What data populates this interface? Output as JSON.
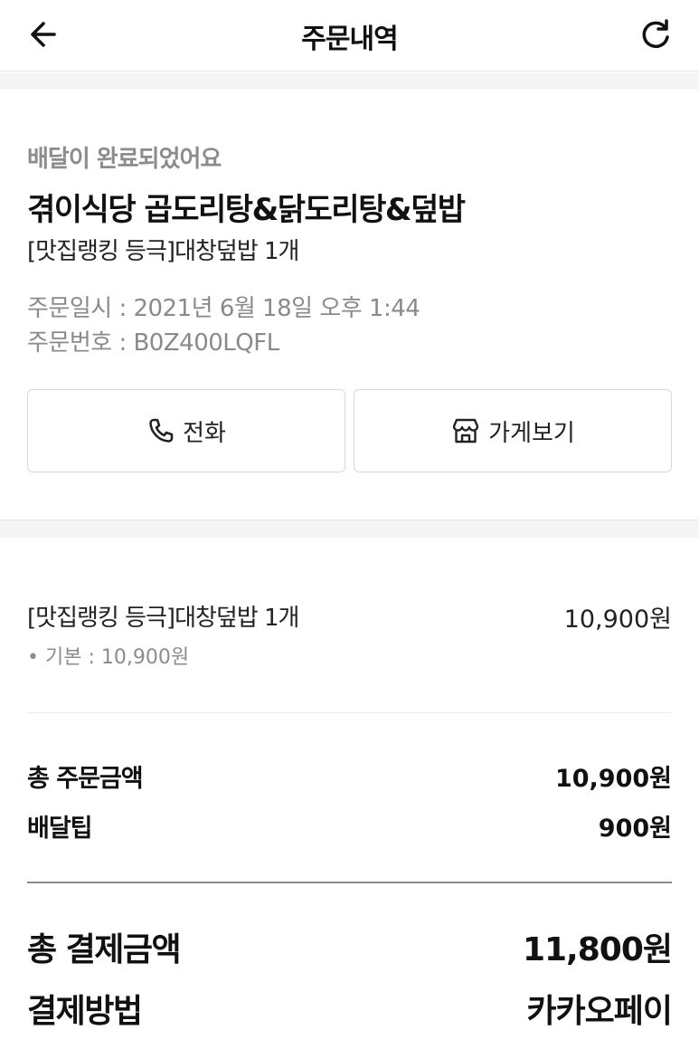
{
  "header": {
    "title": "주문내역",
    "back_icon": "arrow-left-icon",
    "refresh_icon": "refresh-icon"
  },
  "order": {
    "status": "배달이 완료되었어요",
    "store_name": "겪이식당 곱도리탕&닭도리탕&덮밥",
    "menu_summary": "[맛집랭킹 등극]대창덮밥 1개",
    "order_time": "주문일시 : 2021년 6월 18일 오후 1:44",
    "order_number": "주문번호 : B0Z400LQFL"
  },
  "actions": {
    "call_label": "전화",
    "call_icon": "phone-icon",
    "store_label": "가게보기",
    "store_icon": "store-icon"
  },
  "items": [
    {
      "name": "[맛집랭킹 등극]대창덮밥 1개",
      "price": "10,900원",
      "option": "• 기본 : 10,900원"
    }
  ],
  "summary": {
    "total_order_label": "총 주문금액",
    "total_order_value": "10,900원",
    "delivery_tip_label": "배달팁",
    "delivery_tip_value": "900원"
  },
  "payment": {
    "total_payment_label": "총 결제금액",
    "total_payment_value": "11,800원",
    "method_label": "결제방법",
    "method_value": "카카오페이"
  }
}
